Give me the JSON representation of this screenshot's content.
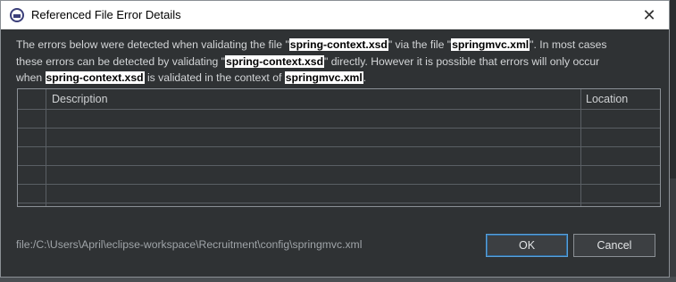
{
  "window": {
    "title": "Referenced File Error Details",
    "close_glyph": "✕",
    "icon": "eclipse-icon"
  },
  "message": {
    "line1_a": "The errors below were detected when validating the file \"",
    "file1": "spring-context.xsd",
    "line1_b": "\" via the file \"",
    "file2": "springmvc.xml",
    "line1_c": "\".  In most cases",
    "line2_a": "these errors can be detected by validating \"",
    "file3": "spring-context.xsd",
    "line2_b": "\" directly.  However it is possible that errors will only occur",
    "line3_a": "when ",
    "file4": "spring-context.xsd",
    "line3_b": " is validated in the context of ",
    "file5": "springmvc.xml",
    "line3_c": "."
  },
  "table": {
    "columns": [
      "Description",
      "Location"
    ],
    "rows": []
  },
  "footer": {
    "path": "file:/C:\\Users\\April\\eclipse-workspace\\Recruitment\\config\\springmvc.xml"
  },
  "buttons": {
    "ok_label": "OK",
    "cancel_label": "Cancel"
  },
  "colors": {
    "dialog_bg": "#2f3234",
    "titlebar_bg": "#ffffff",
    "highlight_bg": "#ffffff",
    "ok_focus_border": "#5aa0d8"
  }
}
